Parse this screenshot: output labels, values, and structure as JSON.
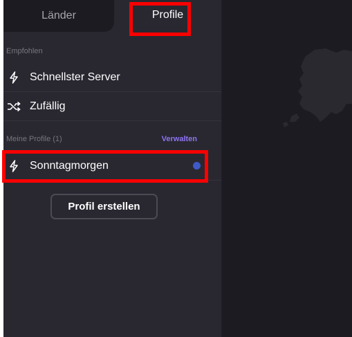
{
  "tabs": {
    "countries_label": "Länder",
    "profiles_label": "Profile"
  },
  "recommended": {
    "section_label": "Empfohlen",
    "items": [
      {
        "label": "Schnellster Server",
        "icon": "bolt-icon"
      },
      {
        "label": "Zufällig",
        "icon": "shuffle-icon"
      }
    ]
  },
  "my_profiles": {
    "section_label": "Meine Profile (1)",
    "manage_label": "Verwalten",
    "items": [
      {
        "label": "Sonntagmorgen",
        "icon": "bolt-icon",
        "status": "active"
      }
    ]
  },
  "create_button": {
    "label": "Profil erstellen"
  },
  "colors": {
    "accent": "#8e73f0",
    "status_dot": "#3d5ac6",
    "highlight": "#ff0000"
  }
}
